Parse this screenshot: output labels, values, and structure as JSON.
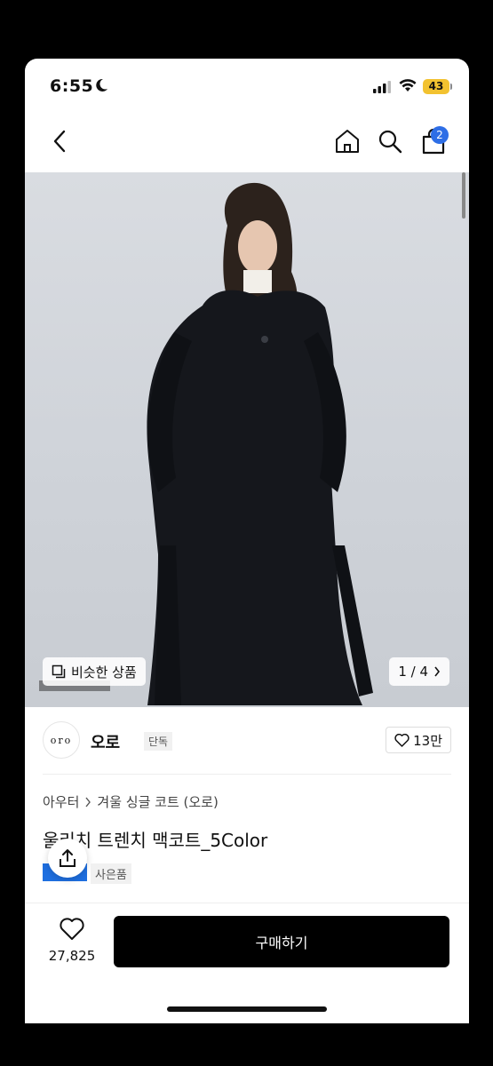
{
  "status": {
    "time": "6:55",
    "battery": "43"
  },
  "nav": {
    "cart_count": "2"
  },
  "image": {
    "similar_label": "비슷한 상품",
    "pager": "1 / 4"
  },
  "brand": {
    "logo_text": "oro",
    "name": "오로",
    "badge": "단독",
    "likes": "13만"
  },
  "info": {
    "breadcrumb": [
      "아우터",
      "겨울 싱글 코트 (오로)"
    ],
    "title": "울리치 트렌치 맥코트_5Color",
    "gift_badge": "사은품"
  },
  "bottom": {
    "wish_count": "27,825",
    "buy_label": "구매하기"
  },
  "colors": {
    "accent": "#2e6ee6",
    "battery": "#f2c230",
    "buy": "#000000"
  },
  "icons": [
    "moon-icon",
    "signal-icon",
    "wifi-icon",
    "back-arrow-icon",
    "home-icon",
    "search-icon",
    "cart-icon",
    "similar-icon",
    "chevron-right-icon",
    "heart-icon",
    "share-icon"
  ]
}
